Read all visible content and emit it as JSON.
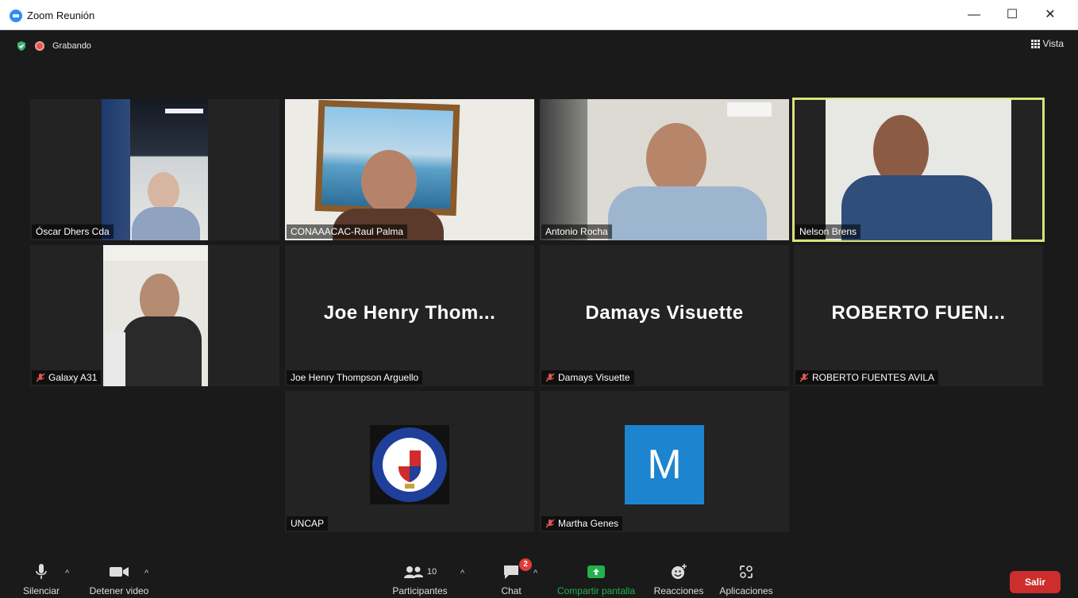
{
  "window": {
    "title": "Zoom Reunión",
    "minimize": "—",
    "maximize": "☐",
    "close": "✕"
  },
  "meeting": {
    "recording_label": "Grabando",
    "view_label": "Vista"
  },
  "participants": [
    {
      "name": "Óscar Dhers Cda",
      "muted": false,
      "video": true
    },
    {
      "name": "CONAAACAC-Raul Palma",
      "muted": false,
      "video": true
    },
    {
      "name": "Antonio Rocha",
      "muted": false,
      "video": true
    },
    {
      "name": "Nelson Brens",
      "muted": false,
      "video": true,
      "active_speaker": true
    },
    {
      "name": "Galaxy A31",
      "muted": true,
      "video": true
    },
    {
      "name": "Joe Henry Thompson Arguello",
      "display_name": "Joe Henry Thom...",
      "muted": false,
      "video": false
    },
    {
      "name": "Damays Visuette",
      "display_name": "Damays Visuette",
      "muted": true,
      "video": false
    },
    {
      "name": "ROBERTO FUENTES AVILA",
      "display_name": "ROBERTO FUEN...",
      "muted": true,
      "video": false
    },
    {
      "name": "UNCAP",
      "muted": false,
      "video": false,
      "avatar": "uncap-seal"
    },
    {
      "name": "Martha Genes",
      "muted": true,
      "video": false,
      "avatar_letter": "M",
      "avatar_color": "#1d85d0"
    }
  ],
  "toolbar": {
    "mute_label": "Silenciar",
    "video_label": "Detener video",
    "participants_label": "Participantes",
    "participants_count": "10",
    "chat_label": "Chat",
    "chat_badge": "2",
    "share_label": "Compartir pantalla",
    "reactions_label": "Reacciones",
    "apps_label": "Aplicaciones",
    "leave_label": "Salir"
  },
  "colors": {
    "share_green": "#22b14c",
    "leave_red": "#cc2e2e",
    "active_outline": "#d9e37a",
    "mute_red": "#e0584f"
  }
}
